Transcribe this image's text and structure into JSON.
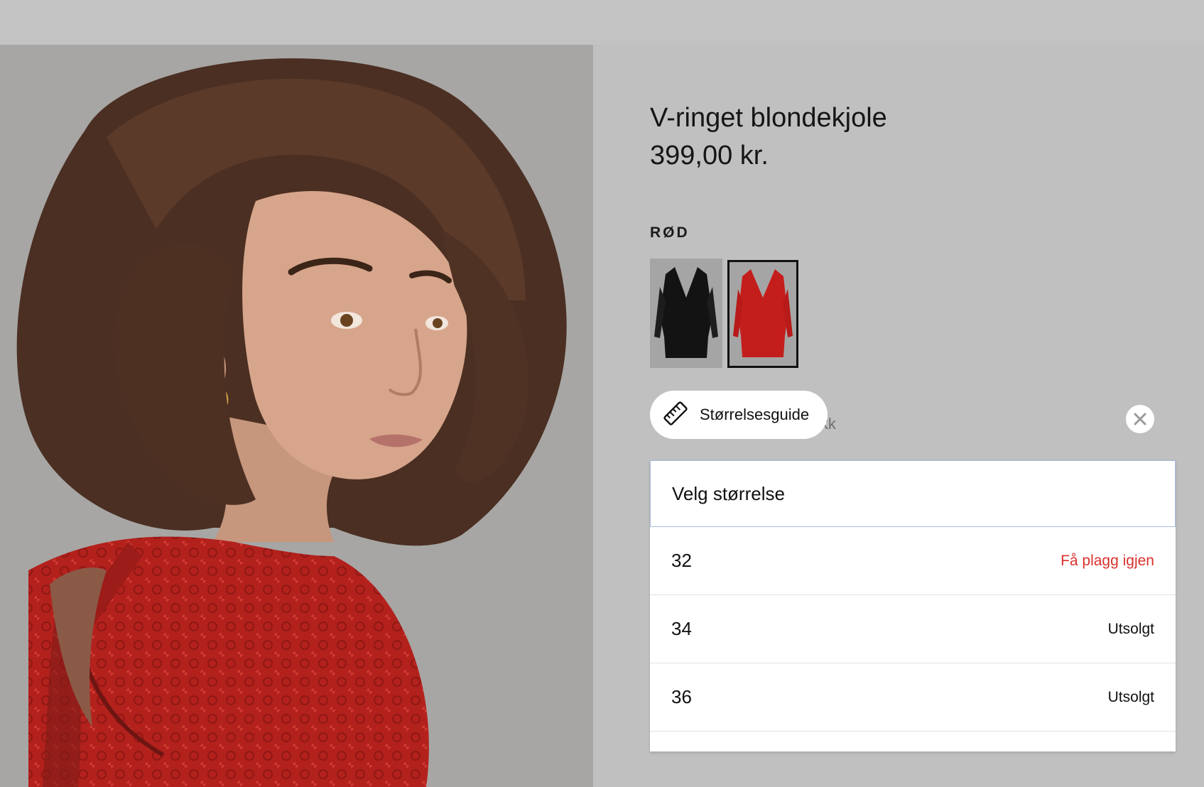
{
  "product": {
    "title": "V-ringet blondekjole",
    "price": "399,00 kr.",
    "color_label": "RØD"
  },
  "swatches": [
    {
      "name": "black",
      "color": "#111111",
      "selected": false
    },
    {
      "name": "red",
      "color": "#c01c1a",
      "selected": true
    }
  ],
  "size_guide": {
    "label": "Størrelsesguide",
    "icon": "ruler-icon",
    "hidden_text": "ikk"
  },
  "size_selector": {
    "placeholder": "Velg størrelse",
    "options": [
      {
        "size": "32",
        "status": "Få plagg igjen",
        "status_color": "#d8312c"
      },
      {
        "size": "34",
        "status": "Utsolgt"
      },
      {
        "size": "36",
        "status": "Utsolgt"
      }
    ]
  },
  "colors": {
    "overlay": "#c0c0c0",
    "accent_red": "#d8312c",
    "dropdown_border": "#a8bde0"
  }
}
